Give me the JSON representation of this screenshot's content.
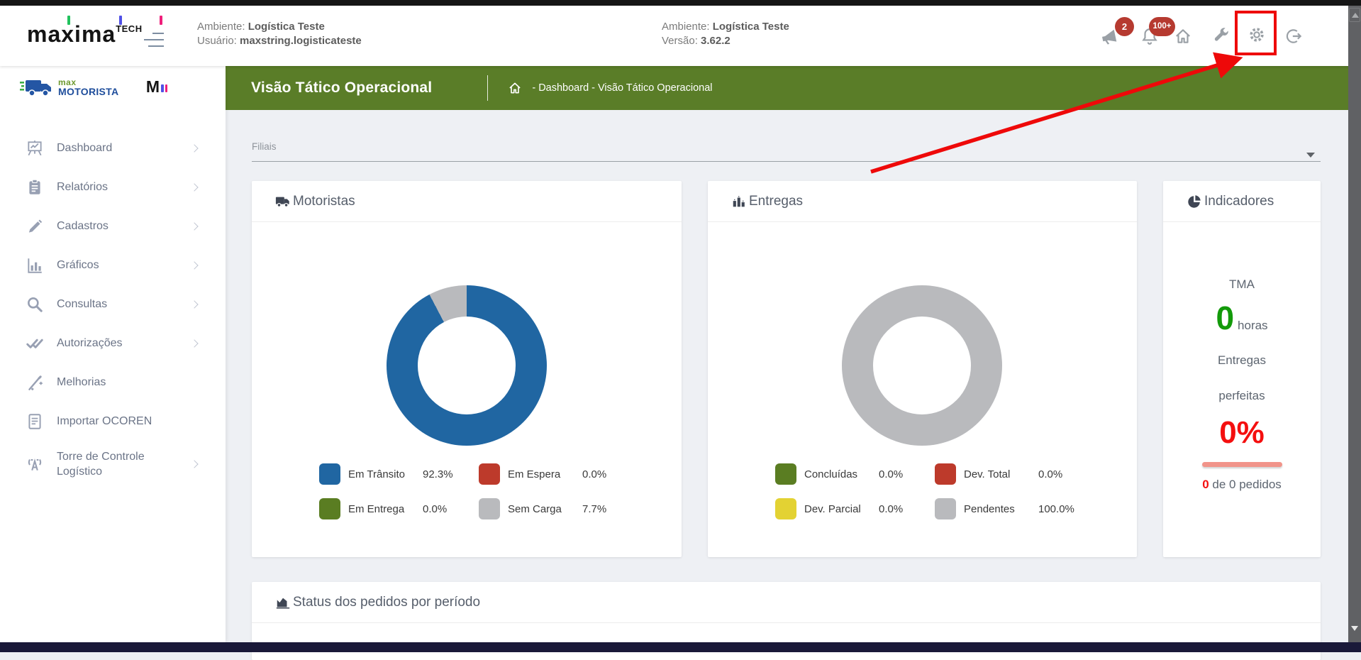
{
  "header": {
    "brand": {
      "word": "maxima",
      "sub": "TECH"
    },
    "col1": {
      "label1": "Ambiente:",
      "value1": "Logística Teste",
      "label2": "Usuário:",
      "value2": "maxstring.logisticateste"
    },
    "col2": {
      "label1": "Ambiente:",
      "value1": "Logística Teste",
      "label2": "Versão:",
      "value2": "3.62.2"
    },
    "badges": {
      "alerts": "2",
      "notifications": "100+"
    }
  },
  "titlebar": {
    "title": "Visão Tático Operacional",
    "breadcrumb": "- Dashboard - Visão Tático Operacional"
  },
  "sidebar": {
    "logo": {
      "top": "max",
      "bottom": "MOTORISTA",
      "mini": "M"
    },
    "items": [
      {
        "label": "Dashboard"
      },
      {
        "label": "Relatórios"
      },
      {
        "label": "Cadastros"
      },
      {
        "label": "Gráficos"
      },
      {
        "label": "Consultas"
      },
      {
        "label": "Autorizações"
      },
      {
        "label": "Melhorias"
      },
      {
        "label": "Importar OCOREN"
      },
      {
        "label": "Torre de Controle Logístico"
      }
    ]
  },
  "filters": {
    "filiais_label": "Filiais"
  },
  "cards": {
    "motoristas": {
      "title": "Motoristas",
      "legend": [
        {
          "label": "Em Trânsito",
          "value": "92.3%",
          "color": "#2066a2"
        },
        {
          "label": "Em Espera",
          "value": "0.0%",
          "color": "#bd3a2b"
        },
        {
          "label": "Em Entrega",
          "value": "0.0%",
          "color": "#5a7d22"
        },
        {
          "label": "Sem Carga",
          "value": "7.7%",
          "color": "#b9babd"
        }
      ]
    },
    "entregas": {
      "title": "Entregas",
      "legend": [
        {
          "label": "Concluídas",
          "value": "0.0%",
          "color": "#5a7d22"
        },
        {
          "label": "Dev. Total",
          "value": "0.0%",
          "color": "#bd3a2b"
        },
        {
          "label": "Dev. Parcial",
          "value": "0.0%",
          "color": "#e3d233"
        },
        {
          "label": "Pendentes",
          "value": "100.0%",
          "color": "#b9babd"
        }
      ]
    },
    "indicadores": {
      "title": "Indicadores",
      "tma_label": "TMA",
      "tma_value": "0",
      "tma_unit": "horas",
      "line1": "Entregas",
      "line2": "perfeitas",
      "percent": "0%",
      "footer_value": "0",
      "footer_text": " de 0 pedidos"
    },
    "status": {
      "title": "Status dos pedidos por período"
    }
  },
  "chart_data": [
    {
      "type": "pie",
      "title": "Motoristas",
      "labels": [
        "Em Trânsito",
        "Em Espera",
        "Em Entrega",
        "Sem Carga"
      ],
      "values": [
        92.3,
        0.0,
        0.0,
        7.7
      ],
      "colors": [
        "#2066a2",
        "#bd3a2b",
        "#5a7d22",
        "#b9babd"
      ],
      "donut": true,
      "legend_position": "bottom"
    },
    {
      "type": "pie",
      "title": "Entregas",
      "labels": [
        "Concluídas",
        "Dev. Total",
        "Dev. Parcial",
        "Pendentes"
      ],
      "values": [
        0.0,
        0.0,
        0.0,
        100.0
      ],
      "colors": [
        "#5a7d22",
        "#bd3a2b",
        "#e3d233",
        "#b9babd"
      ],
      "donut": true,
      "legend_position": "bottom"
    }
  ],
  "colors": {
    "titlebar_green": "#5a7d28",
    "badge_red": "#b63a30",
    "indicator_green": "#139a0a",
    "indicator_red": "#f40f0f",
    "indicator_bar_pink": "#f1948a",
    "annotation_red": "#ee0909",
    "sidebar_text": "#6b7487",
    "background": "#eef0f4"
  }
}
